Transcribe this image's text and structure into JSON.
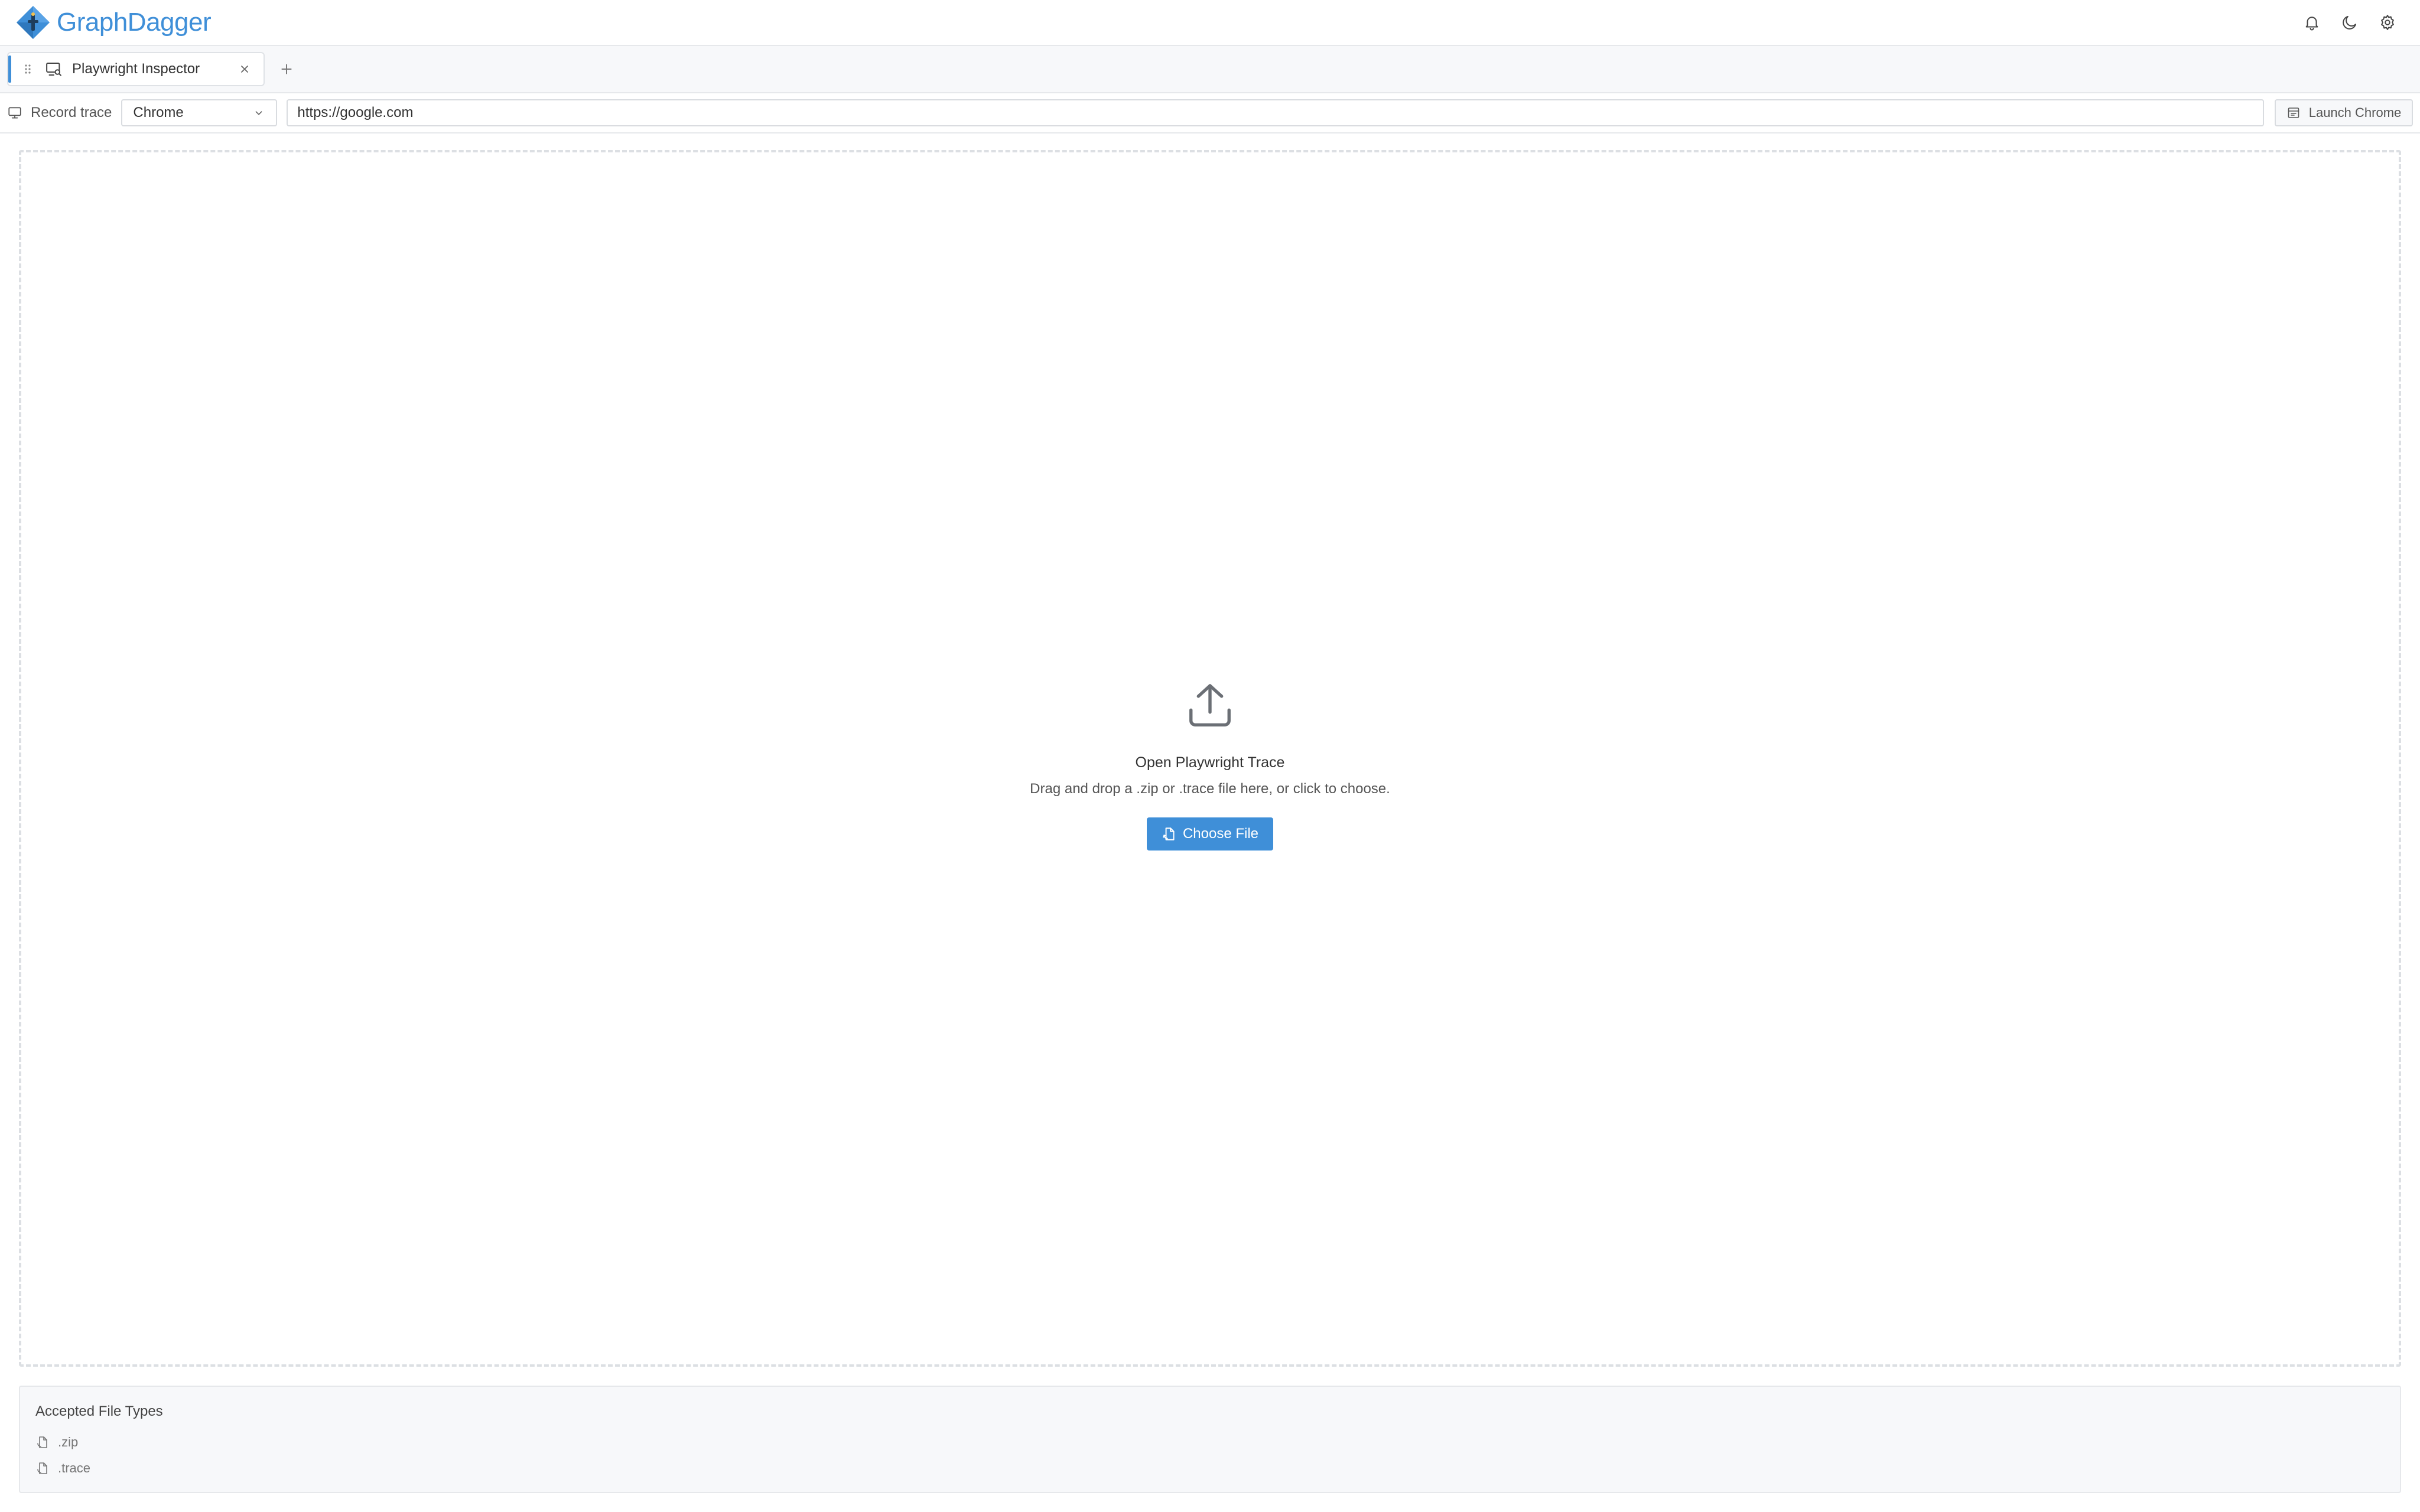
{
  "app": {
    "name": "GraphDagger",
    "accent_color": "#3f8fd8"
  },
  "header": {
    "icons": [
      "bell-icon",
      "moon-icon",
      "gear-icon"
    ]
  },
  "tabs": [
    {
      "label": "Playwright Inspector",
      "icon": "browser-search-icon",
      "active": true
    }
  ],
  "toolbar": {
    "record_label": "Record trace",
    "browser_select": "Chrome",
    "url_value": "https://google.com",
    "launch_label": "Launch Chrome"
  },
  "dropzone": {
    "title": "Open Playwright Trace",
    "subtitle": "Drag and drop a .zip or .trace file here, or click to choose.",
    "button_label": "Choose File"
  },
  "accepted": {
    "title": "Accepted File Types",
    "types": [
      ".zip",
      ".trace"
    ]
  }
}
